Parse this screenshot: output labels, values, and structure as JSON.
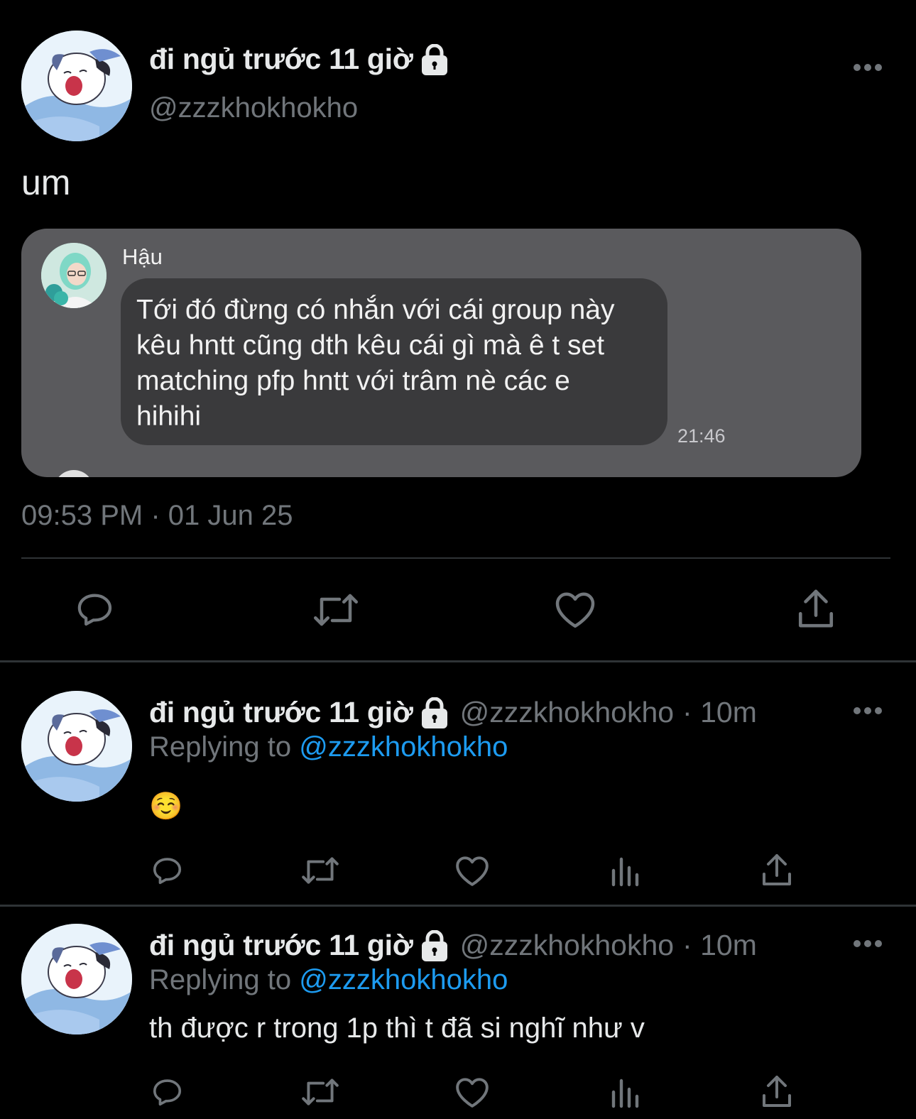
{
  "main_tweet": {
    "display_name": "đi ngủ trước 11 giờ",
    "handle": "@zzzkhokhokho",
    "text": "um",
    "timestamp": "09:53 PM · 01 Jun 25",
    "embedded_image": {
      "sender": "Hậu",
      "message": "Tới đó đừng có nhắn với cái group này\nkêu hntt cũng dth kêu cái gì mà ê t set\nmatching pfp hntt với trâm nè các e\nhihihi",
      "time": "21:46"
    },
    "actions": [
      "reply-icon",
      "retweet-icon",
      "like-icon",
      "share-icon"
    ]
  },
  "replies": [
    {
      "display_name": "đi ngủ trước 11 giờ",
      "handle": "@zzzkhokhokho",
      "time": "· 10m",
      "replying_label": "Replying to",
      "replying_to": "@zzzkhokhokho",
      "text": "☺️",
      "actions": [
        "reply-icon",
        "retweet-icon",
        "like-icon",
        "views-icon",
        "share-icon"
      ]
    },
    {
      "display_name": "đi ngủ trước 11 giờ",
      "handle": "@zzzkhokhokho",
      "time": "· 10m",
      "replying_label": "Replying to",
      "replying_to": "@zzzkhokhokho",
      "text": "th được r trong 1p thì t đã si nghĩ như v",
      "actions": [
        "reply-icon",
        "retweet-icon",
        "like-icon",
        "views-icon",
        "share-icon"
      ]
    }
  ],
  "colors": {
    "background": "#000000",
    "text": "#e7e9ea",
    "secondary": "#71767b",
    "link": "#1d9bf0",
    "divider": "#2f3336"
  }
}
